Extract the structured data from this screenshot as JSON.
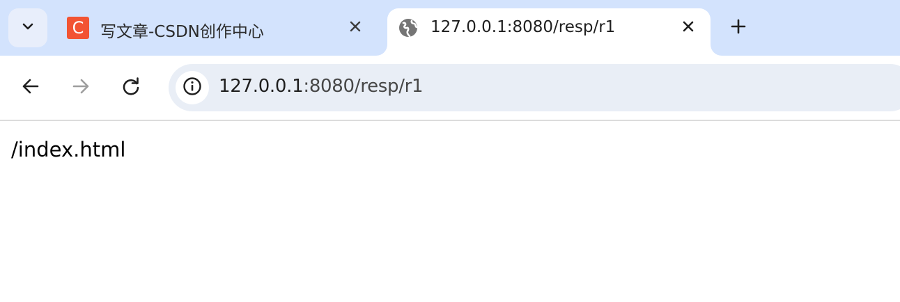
{
  "tabs": [
    {
      "title": "写文章-CSDN创作中心",
      "favicon_letter": "C",
      "favicon_color": "#f25433",
      "active": false
    },
    {
      "title": "127.0.0.1:8080/resp/r1",
      "favicon": "globe-icon",
      "active": true
    }
  ],
  "toolbar": {
    "back_icon": "arrow-left-icon",
    "forward_icon": "arrow-right-icon",
    "reload_icon": "reload-icon",
    "site_info_icon": "info-icon"
  },
  "address_bar": {
    "host": "127.0.0.1",
    "path": ":8080/resp/r1"
  },
  "page": {
    "body_text": "/index.html"
  },
  "colors": {
    "tabstrip_bg": "#d3e3fd",
    "omnibox_bg": "#e9eef6"
  }
}
